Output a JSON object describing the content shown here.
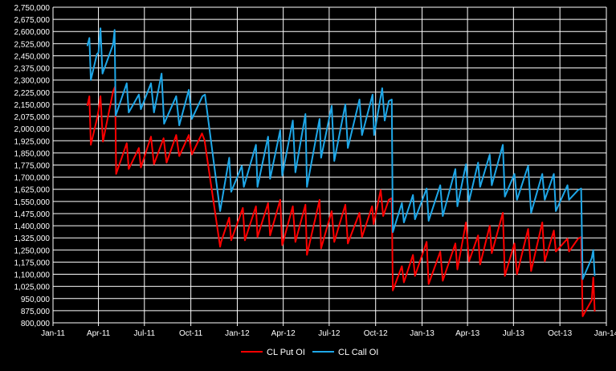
{
  "chart_data": {
    "type": "line",
    "title": "",
    "xlabel": "",
    "ylabel": "",
    "ylim": [
      800000,
      2750000
    ],
    "ytick_step": 75000,
    "y_ticks": [
      "800,000",
      "875,000",
      "950,000",
      "1,025,000",
      "1,100,000",
      "1,175,000",
      "1,250,000",
      "1,325,000",
      "1,400,000",
      "1,475,000",
      "1,550,000",
      "1,625,000",
      "1,700,000",
      "1,775,000",
      "1,850,000",
      "1,925,000",
      "2,000,000",
      "2,075,000",
      "2,150,000",
      "2,225,000",
      "2,300,000",
      "2,375,000",
      "2,450,000",
      "2,525,000",
      "2,600,000",
      "2,675,000",
      "2,750,000"
    ],
    "xlim": [
      "2011-01-01",
      "2014-01-01"
    ],
    "x_ticks": [
      {
        "date": "2011-01-01",
        "label": "Jan-11"
      },
      {
        "date": "2011-04-01",
        "label": "Apr-11"
      },
      {
        "date": "2011-07-01",
        "label": "Jul-11"
      },
      {
        "date": "2011-10-01",
        "label": "Oct-11"
      },
      {
        "date": "2012-01-01",
        "label": "Jan-12"
      },
      {
        "date": "2012-04-01",
        "label": "Apr-12"
      },
      {
        "date": "2012-07-01",
        "label": "Jul-12"
      },
      {
        "date": "2012-10-01",
        "label": "Oct-12"
      },
      {
        "date": "2013-01-01",
        "label": "Jan-13"
      },
      {
        "date": "2013-04-01",
        "label": "Apr-13"
      },
      {
        "date": "2013-07-01",
        "label": "Jul-13"
      },
      {
        "date": "2013-10-01",
        "label": "Oct-13"
      },
      {
        "date": "2014-01-01",
        "label": "Jan-14"
      }
    ],
    "grid": true,
    "legend": "bottom-center",
    "series": [
      {
        "name": "CL Put OI",
        "color": "#ff0000",
        "points": [
          [
            "2011-03-10",
            2140000
          ],
          [
            "2011-03-14",
            2200000
          ],
          [
            "2011-03-17",
            1900000
          ],
          [
            "2011-03-29",
            2060000
          ],
          [
            "2011-04-01",
            2110000
          ],
          [
            "2011-04-05",
            2200000
          ],
          [
            "2011-04-10",
            1920000
          ],
          [
            "2011-04-30",
            2230000
          ],
          [
            "2011-05-04",
            2260000
          ],
          [
            "2011-05-06",
            1720000
          ],
          [
            "2011-05-27",
            1910000
          ],
          [
            "2011-05-31",
            1750000
          ],
          [
            "2011-06-20",
            1880000
          ],
          [
            "2011-06-24",
            1760000
          ],
          [
            "2011-07-14",
            1950000
          ],
          [
            "2011-07-20",
            1780000
          ],
          [
            "2011-08-08",
            1940000
          ],
          [
            "2011-08-14",
            1790000
          ],
          [
            "2011-09-02",
            1960000
          ],
          [
            "2011-09-08",
            1830000
          ],
          [
            "2011-09-27",
            1960000
          ],
          [
            "2011-10-03",
            1840000
          ],
          [
            "2011-10-23",
            1970000
          ],
          [
            "2011-10-28",
            1930000
          ],
          [
            "2011-11-28",
            1270000
          ],
          [
            "2011-11-30",
            1300000
          ],
          [
            "2011-12-16",
            1450000
          ],
          [
            "2011-12-20",
            1310000
          ],
          [
            "2012-01-12",
            1510000
          ],
          [
            "2012-01-16",
            1310000
          ],
          [
            "2012-02-07",
            1520000
          ],
          [
            "2012-02-10",
            1330000
          ],
          [
            "2012-03-02",
            1540000
          ],
          [
            "2012-03-06",
            1340000
          ],
          [
            "2012-03-26",
            1560000
          ],
          [
            "2012-03-30",
            1280000
          ],
          [
            "2012-04-20",
            1520000
          ],
          [
            "2012-04-25",
            1300000
          ],
          [
            "2012-05-15",
            1530000
          ],
          [
            "2012-05-18",
            1220000
          ],
          [
            "2012-06-12",
            1560000
          ],
          [
            "2012-06-15",
            1260000
          ],
          [
            "2012-07-06",
            1490000
          ],
          [
            "2012-07-11",
            1300000
          ],
          [
            "2012-08-02",
            1530000
          ],
          [
            "2012-08-07",
            1290000
          ],
          [
            "2012-08-30",
            1480000
          ],
          [
            "2012-09-04",
            1330000
          ],
          [
            "2012-09-24",
            1520000
          ],
          [
            "2012-09-27",
            1410000
          ],
          [
            "2012-10-11",
            1620000
          ],
          [
            "2012-10-16",
            1460000
          ],
          [
            "2012-10-27",
            1560000
          ],
          [
            "2012-11-02",
            1570000
          ],
          [
            "2012-11-04",
            1000000
          ],
          [
            "2012-11-22",
            1150000
          ],
          [
            "2012-11-26",
            1050000
          ],
          [
            "2012-12-14",
            1220000
          ],
          [
            "2012-12-18",
            1090000
          ],
          [
            "2013-01-10",
            1300000
          ],
          [
            "2013-01-14",
            1040000
          ],
          [
            "2013-02-06",
            1240000
          ],
          [
            "2013-02-11",
            1060000
          ],
          [
            "2013-03-08",
            1290000
          ],
          [
            "2013-03-12",
            1130000
          ],
          [
            "2013-03-29",
            1420000
          ],
          [
            "2013-04-04",
            1180000
          ],
          [
            "2013-04-22",
            1340000
          ],
          [
            "2013-04-26",
            1160000
          ],
          [
            "2013-05-15",
            1400000
          ],
          [
            "2013-05-19",
            1230000
          ],
          [
            "2013-06-10",
            1480000
          ],
          [
            "2013-06-14",
            1090000
          ],
          [
            "2013-07-03",
            1290000
          ],
          [
            "2013-07-08",
            1100000
          ],
          [
            "2013-07-30",
            1380000
          ],
          [
            "2013-08-05",
            1120000
          ],
          [
            "2013-08-27",
            1420000
          ],
          [
            "2013-09-01",
            1180000
          ],
          [
            "2013-09-19",
            1370000
          ],
          [
            "2013-09-23",
            1240000
          ],
          [
            "2013-10-16",
            1320000
          ],
          [
            "2013-10-19",
            1240000
          ],
          [
            "2013-11-06",
            1320000
          ],
          [
            "2013-11-12",
            1330000
          ],
          [
            "2013-11-15",
            840000
          ],
          [
            "2013-12-03",
            940000
          ],
          [
            "2013-12-06",
            1080000
          ],
          [
            "2013-12-09",
            870000
          ]
        ]
      },
      {
        "name": "CL Call OI",
        "color": "#1ea7e8",
        "points": [
          [
            "2011-03-10",
            2510000
          ],
          [
            "2011-03-14",
            2560000
          ],
          [
            "2011-03-17",
            2300000
          ],
          [
            "2011-03-29",
            2460000
          ],
          [
            "2011-04-01",
            2470000
          ],
          [
            "2011-04-05",
            2620000
          ],
          [
            "2011-04-09",
            2340000
          ],
          [
            "2011-04-30",
            2520000
          ],
          [
            "2011-05-03",
            2610000
          ],
          [
            "2011-05-05",
            2080000
          ],
          [
            "2011-05-27",
            2280000
          ],
          [
            "2011-05-31",
            2100000
          ],
          [
            "2011-06-20",
            2210000
          ],
          [
            "2011-06-24",
            2120000
          ],
          [
            "2011-07-14",
            2280000
          ],
          [
            "2011-07-20",
            2100000
          ],
          [
            "2011-08-04",
            2340000
          ],
          [
            "2011-08-09",
            2030000
          ],
          [
            "2011-09-02",
            2200000
          ],
          [
            "2011-09-08",
            2020000
          ],
          [
            "2011-09-27",
            2240000
          ],
          [
            "2011-10-03",
            2060000
          ],
          [
            "2011-10-24",
            2200000
          ],
          [
            "2011-10-29",
            2210000
          ],
          [
            "2011-11-28",
            1490000
          ],
          [
            "2011-12-16",
            1820000
          ],
          [
            "2011-12-20",
            1610000
          ],
          [
            "2012-01-10",
            1770000
          ],
          [
            "2012-01-14",
            1640000
          ],
          [
            "2012-02-07",
            1900000
          ],
          [
            "2012-02-10",
            1640000
          ],
          [
            "2012-03-02",
            1950000
          ],
          [
            "2012-03-06",
            1690000
          ],
          [
            "2012-03-26",
            1990000
          ],
          [
            "2012-03-30",
            1710000
          ],
          [
            "2012-04-20",
            2050000
          ],
          [
            "2012-04-25",
            1730000
          ],
          [
            "2012-05-15",
            2090000
          ],
          [
            "2012-05-18",
            1640000
          ],
          [
            "2012-06-12",
            2060000
          ],
          [
            "2012-06-15",
            1820000
          ],
          [
            "2012-07-06",
            2140000
          ],
          [
            "2012-07-11",
            1800000
          ],
          [
            "2012-08-02",
            2150000
          ],
          [
            "2012-08-07",
            1880000
          ],
          [
            "2012-08-30",
            2180000
          ],
          [
            "2012-09-04",
            1960000
          ],
          [
            "2012-09-25",
            2210000
          ],
          [
            "2012-09-28",
            1960000
          ],
          [
            "2012-10-14",
            2250000
          ],
          [
            "2012-10-19",
            2050000
          ],
          [
            "2012-10-27",
            2170000
          ],
          [
            "2012-11-02",
            2180000
          ],
          [
            "2012-11-04",
            1360000
          ],
          [
            "2012-11-22",
            1540000
          ],
          [
            "2012-11-26",
            1420000
          ],
          [
            "2012-12-14",
            1590000
          ],
          [
            "2012-12-18",
            1440000
          ],
          [
            "2013-01-10",
            1630000
          ],
          [
            "2013-01-14",
            1430000
          ],
          [
            "2013-02-06",
            1650000
          ],
          [
            "2013-02-11",
            1460000
          ],
          [
            "2013-03-08",
            1750000
          ],
          [
            "2013-03-12",
            1520000
          ],
          [
            "2013-03-29",
            1780000
          ],
          [
            "2013-04-04",
            1550000
          ],
          [
            "2013-04-22",
            1790000
          ],
          [
            "2013-04-26",
            1640000
          ],
          [
            "2013-05-15",
            1840000
          ],
          [
            "2013-05-19",
            1650000
          ],
          [
            "2013-06-10",
            1900000
          ],
          [
            "2013-06-14",
            1580000
          ],
          [
            "2013-07-03",
            1720000
          ],
          [
            "2013-07-08",
            1560000
          ],
          [
            "2013-07-30",
            1770000
          ],
          [
            "2013-08-05",
            1480000
          ],
          [
            "2013-08-27",
            1720000
          ],
          [
            "2013-09-01",
            1560000
          ],
          [
            "2013-09-19",
            1720000
          ],
          [
            "2013-09-23",
            1490000
          ],
          [
            "2013-10-16",
            1650000
          ],
          [
            "2013-10-19",
            1560000
          ],
          [
            "2013-11-06",
            1620000
          ],
          [
            "2013-11-12",
            1630000
          ],
          [
            "2013-11-15",
            1070000
          ],
          [
            "2013-12-03",
            1200000
          ],
          [
            "2013-12-06",
            1250000
          ],
          [
            "2013-12-09",
            1090000
          ]
        ]
      }
    ]
  }
}
